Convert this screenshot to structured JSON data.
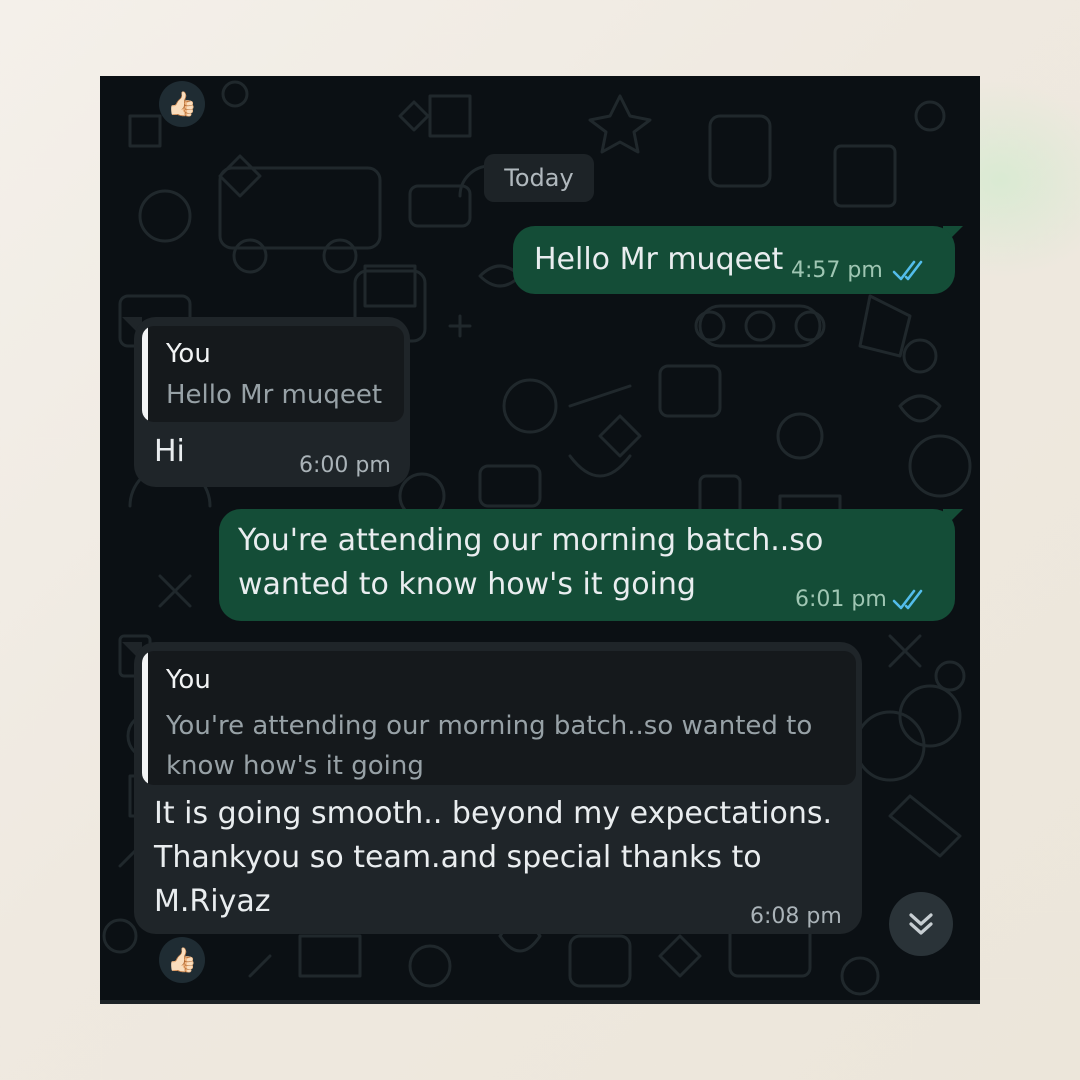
{
  "conversation": {
    "date_separator": "Today",
    "messages": [
      {
        "direction": "outgoing",
        "text": "Hello Mr muqeet",
        "time": "4:57 pm",
        "status": "read"
      },
      {
        "direction": "incoming",
        "reply_to": {
          "author": "You",
          "text": "Hello Mr muqeet"
        },
        "text": "Hi",
        "time": "6:00 pm"
      },
      {
        "direction": "outgoing",
        "text": "You're attending our morning batch..so\nwanted to know how's it going",
        "time": "6:01 pm",
        "status": "read"
      },
      {
        "direction": "incoming",
        "reply_to": {
          "author": "You",
          "text": "You're attending our morning batch..so wanted to\nknow how's it going"
        },
        "text": "It is going smooth.. beyond my expectations.\nThankyou so team.and special thanks to\nM.Riyaz",
        "time": "6:08 pm"
      }
    ],
    "reactions": [
      "👍🏻",
      "👍🏻"
    ]
  },
  "icons": {
    "read_ticks": "double-check-icon",
    "scroll_down": "double-chevron-down-icon",
    "reaction": "thumbs-up-icon"
  },
  "colors": {
    "chat_background": "#0b1014",
    "outgoing_bubble": "#144d37",
    "incoming_bubble": "#1f2529",
    "read_tick": "#53bdeb"
  }
}
